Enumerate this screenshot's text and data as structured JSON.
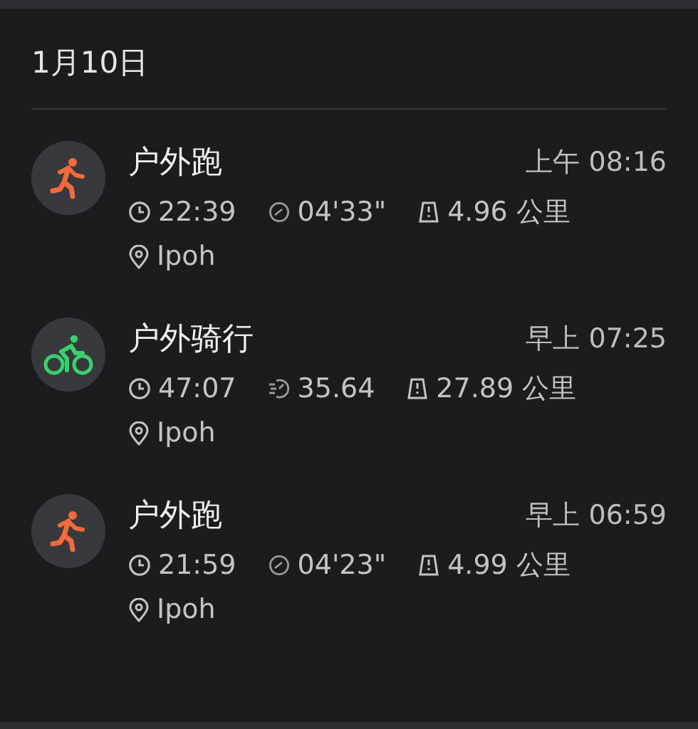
{
  "date_header": "1月10日",
  "activities": [
    {
      "kind": "run",
      "title": "户外跑",
      "time": "上午 08:16",
      "duration": "22:39",
      "speed": "04'33\"",
      "distance": "4.96 公里",
      "location": "Ipoh"
    },
    {
      "kind": "ride",
      "title": "户外骑行",
      "time": "早上 07:25",
      "duration": "47:07",
      "speed": "35.64",
      "distance": "27.89 公里",
      "location": "Ipoh"
    },
    {
      "kind": "run",
      "title": "户外跑",
      "time": "早上 06:59",
      "duration": "21:59",
      "speed": "04'23\"",
      "distance": "4.99 公里",
      "location": "Ipoh"
    }
  ]
}
